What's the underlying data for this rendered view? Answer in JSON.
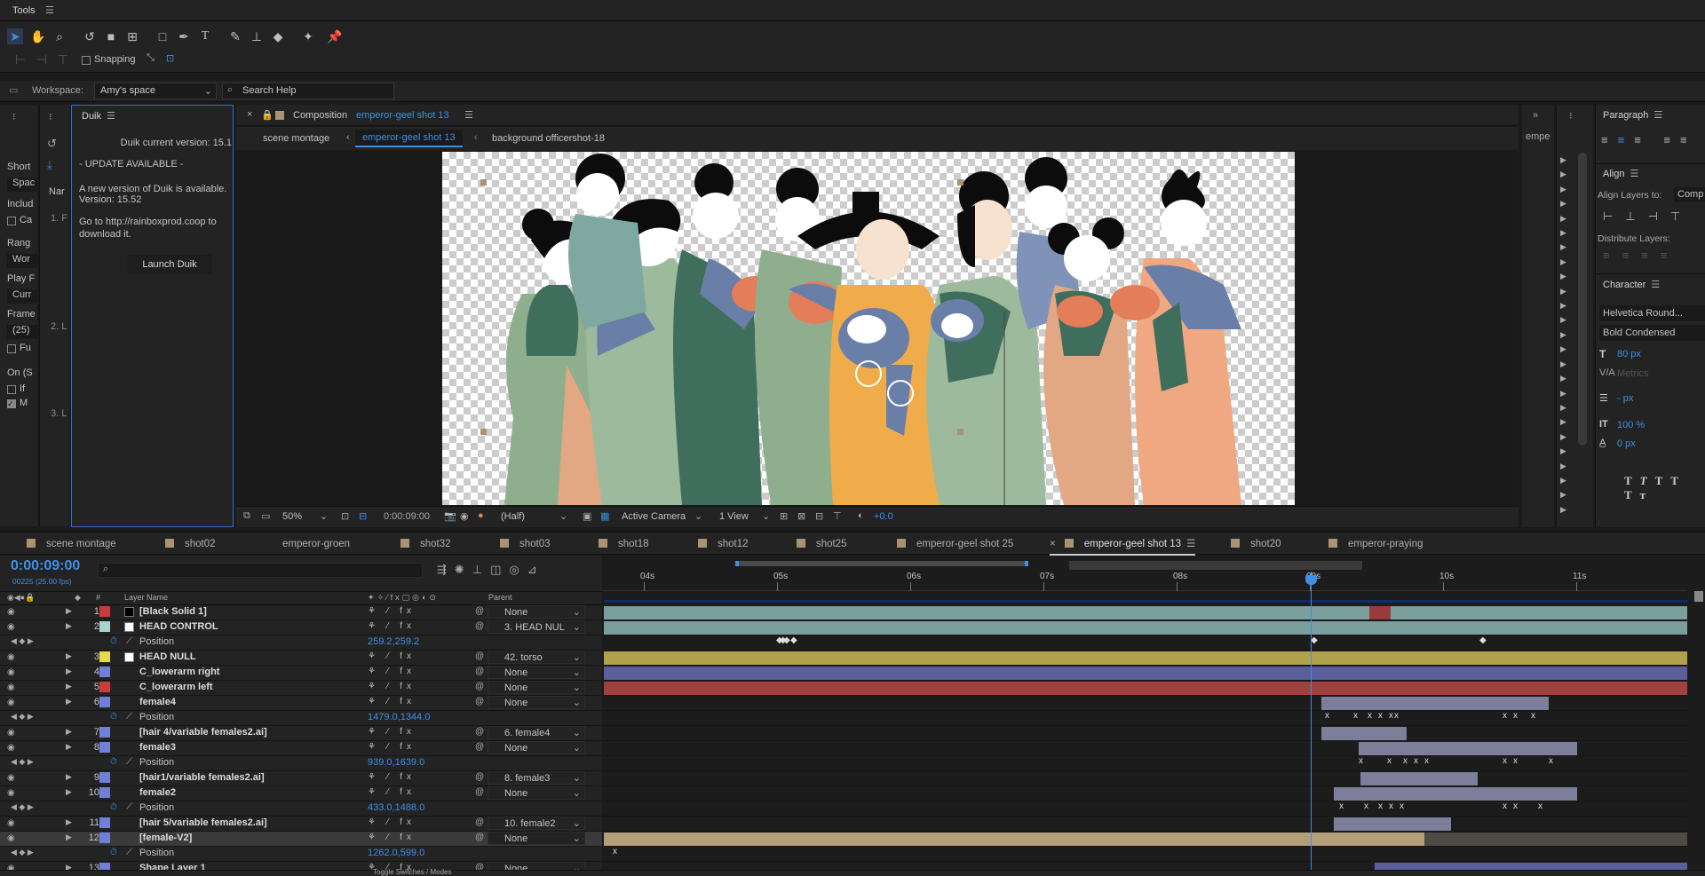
{
  "tools": {
    "title": "Tools",
    "snapping": "Snapping"
  },
  "workspace": {
    "label": "Workspace:",
    "value": "Amy's space",
    "search_placeholder": "Search Help"
  },
  "duik": {
    "title": "Duik",
    "version": "Duik current version: 15.1",
    "update": "- UPDATE AVAILABLE -",
    "new_version": "A new version of Duik is available.",
    "version_num": "Version: 15.52",
    "goto": "Go to http://rainboxprod.coop to download it.",
    "launch": "Launch Duik"
  },
  "left_panel": {
    "items": [
      "Short",
      "Spac",
      "Includ",
      "Ca",
      "Rang",
      "Wor",
      "Play F",
      "Curr",
      "Frame",
      "(25)",
      "Fu",
      "On (S",
      "If",
      "M"
    ],
    "nar": "Nar",
    "steps": [
      "1. F",
      "2. L",
      "3. L"
    ]
  },
  "comp": {
    "title_prefix": "Composition",
    "title": "emperor-geel shot 13",
    "breadcrumbs": [
      "scene montage",
      "emperor-geel shot 13",
      "background officershot-18"
    ],
    "zoom": "50%",
    "timecode": "0:00:09:00",
    "resolution": "(Half)",
    "camera": "Active Camera",
    "view": "1 View",
    "exposure": "+0.0"
  },
  "right_panel": {
    "short_tab": "empe",
    "paragraph": "Paragraph",
    "align": "Align",
    "align_to_label": "Align Layers to:",
    "align_to_value": "Comp",
    "distribute": "Distribute Layers:",
    "character": "Character",
    "font": "Helvetica Round...",
    "style": "Bold Condensed",
    "size": "80 px",
    "tracking": "Metrics",
    "leading": "- px",
    "vscale": "100 %",
    "baseline": "0 px"
  },
  "timeline": {
    "tabs": [
      "scene montage",
      "shot02",
      "emperor-groen",
      "shot32",
      "shot03",
      "shot18",
      "shot12",
      "shot25",
      "emperor-geel shot 25",
      "emperor-geel shot 13",
      "shot20",
      "emperor-praying"
    ],
    "tab_colors": [
      "#a89474",
      "#a89474",
      "#a89474",
      "#a89474",
      "#a89474",
      "#a89474",
      "#a89474",
      "#a89474",
      "#a89474",
      "#a89474",
      "#a89474",
      "#a89474"
    ],
    "timecode": "0:00:09:00",
    "fps": "00225 (25.00 fps)",
    "col_layer": "Layer Name",
    "col_parent": "Parent",
    "ruler": [
      "04s",
      "05s",
      "06s",
      "07s",
      "08s",
      "09s",
      "10s",
      "11s"
    ],
    "layers": [
      {
        "n": "1",
        "name": "[Black Solid 1]",
        "color": "#c83c3c",
        "parent": "None",
        "type": "layer",
        "swatch": "#000000"
      },
      {
        "n": "2",
        "name": "HEAD CONTROL",
        "color": "#a7d4cf",
        "parent": "3. HEAD NUL",
        "type": "layer",
        "swatch": "#ffffff"
      },
      {
        "n": "",
        "name": "Position",
        "value": "259.2,259.2",
        "type": "prop"
      },
      {
        "n": "3",
        "name": "HEAD NULL",
        "color": "#e8d84c",
        "parent": "42. torso",
        "type": "layer",
        "swatch": "#ffffff"
      },
      {
        "n": "4",
        "name": "C_lowerarm right",
        "color": "#7080d8",
        "parent": "None",
        "type": "layer"
      },
      {
        "n": "5",
        "name": "C_lowerarm left",
        "color": "#c83c3c",
        "parent": "None",
        "type": "layer"
      },
      {
        "n": "6",
        "name": "female4",
        "color": "#7080d8",
        "parent": "None",
        "type": "layer"
      },
      {
        "n": "",
        "name": "Position",
        "value": "1479.0,1344.0",
        "type": "prop"
      },
      {
        "n": "7",
        "name": "[hair 4/variable females2.ai]",
        "color": "#7080d8",
        "parent": "6. female4",
        "type": "layer"
      },
      {
        "n": "8",
        "name": "female3",
        "color": "#7080d8",
        "parent": "None",
        "type": "layer"
      },
      {
        "n": "",
        "name": "Position",
        "value": "939.0,1639.0",
        "type": "prop"
      },
      {
        "n": "9",
        "name": "[hair1/variable females2.ai]",
        "color": "#7080d8",
        "parent": "8. female3",
        "type": "layer"
      },
      {
        "n": "10",
        "name": "female2",
        "color": "#7080d8",
        "parent": "None",
        "type": "layer"
      },
      {
        "n": "",
        "name": "Position",
        "value": "433.0,1488.0",
        "type": "prop"
      },
      {
        "n": "11",
        "name": "[hair 5/variable females2.ai]",
        "color": "#7080d8",
        "parent": "10. female2",
        "type": "layer"
      },
      {
        "n": "12",
        "name": "[female-V2]",
        "color": "#7080d8",
        "parent": "None",
        "type": "layer"
      },
      {
        "n": "",
        "name": "Position",
        "value": "1262.0,599.0",
        "type": "prop"
      },
      {
        "n": "13",
        "name": "Shape Layer 1",
        "color": "#7080d8",
        "parent": "None",
        "type": "layer"
      }
    ],
    "bottom": "Toggle Switches / Modes"
  }
}
